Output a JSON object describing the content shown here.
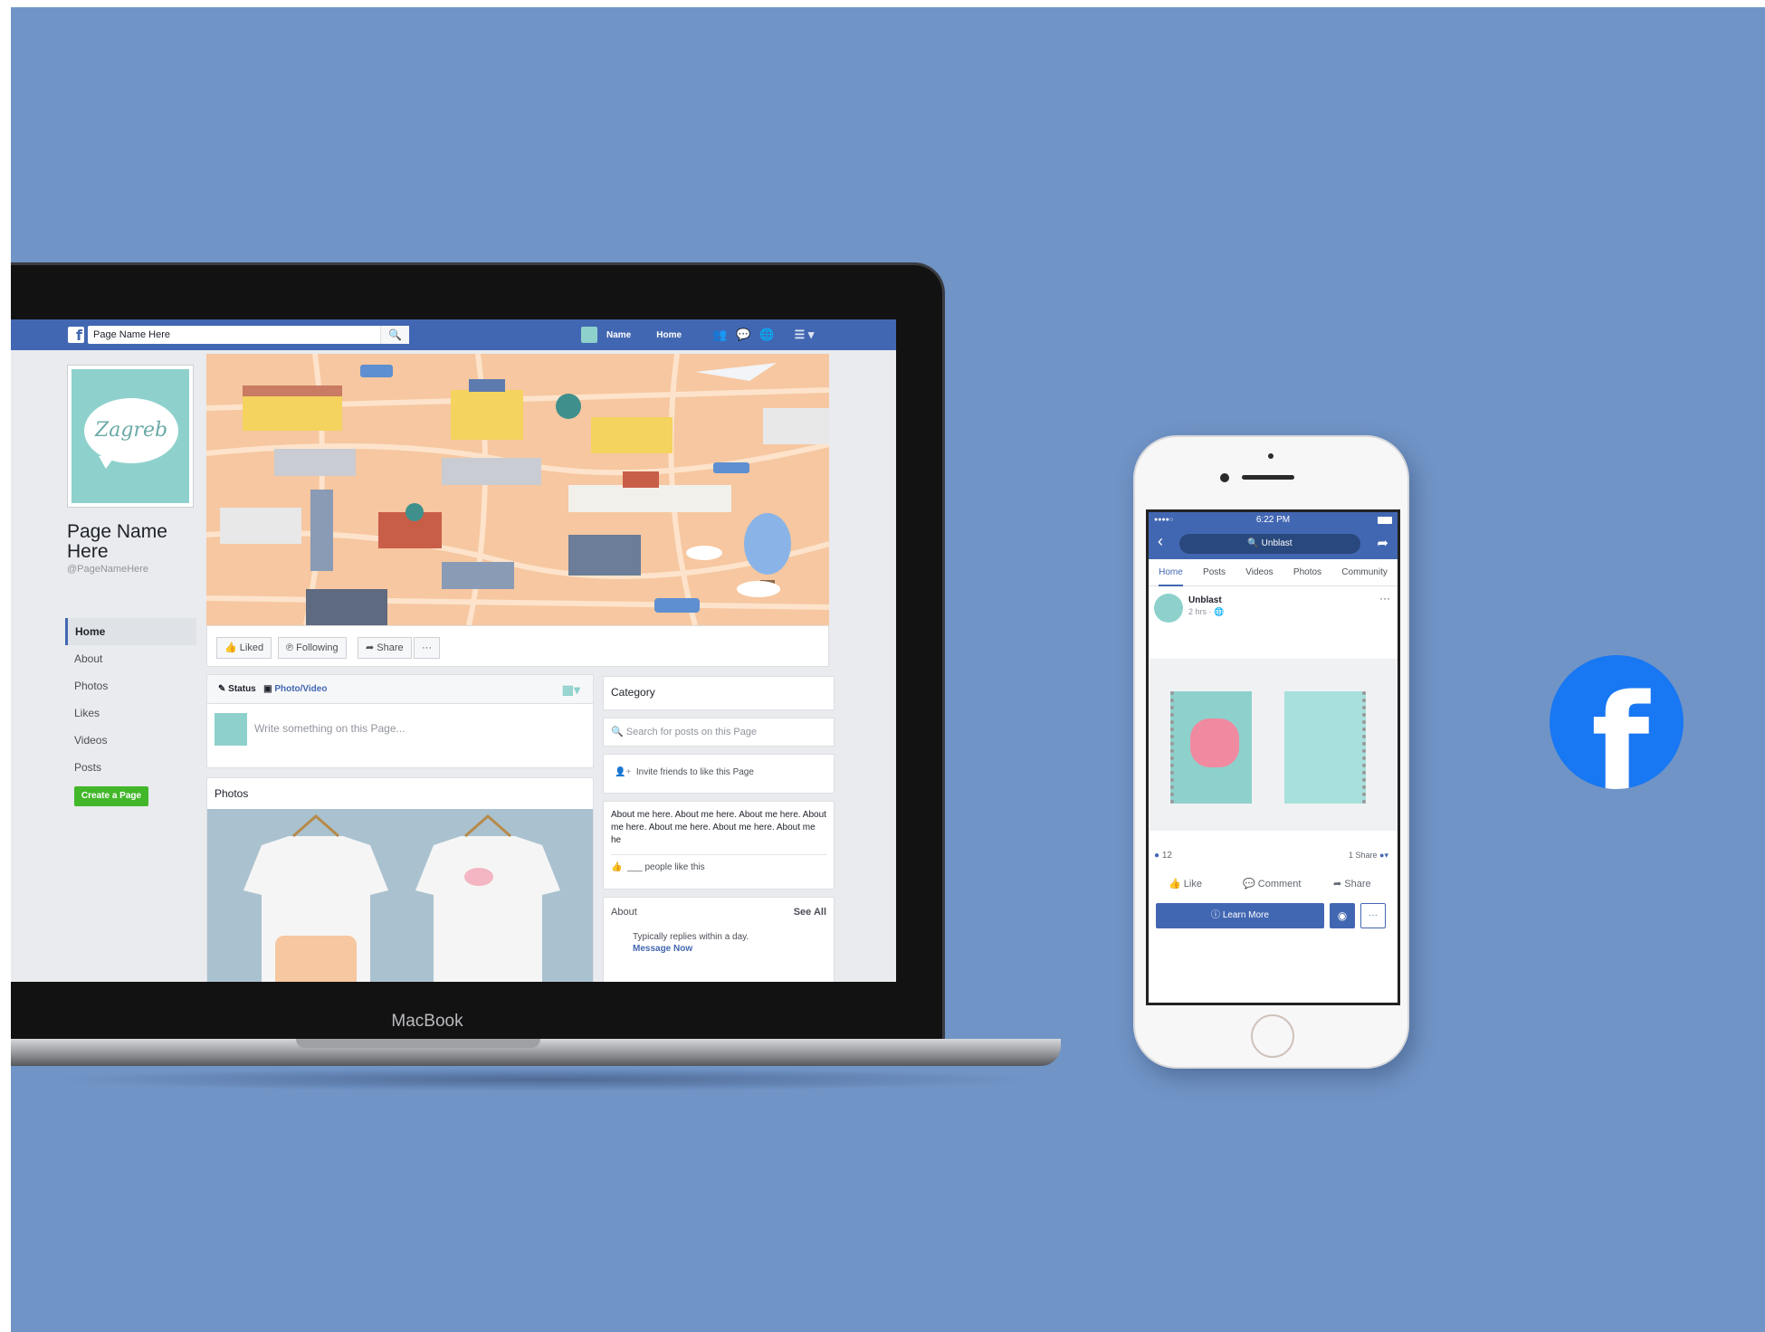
{
  "laptop": {
    "brand_label": "MacBook",
    "fb": {
      "search_value": "Page Name Here",
      "nav": {
        "name": "Name",
        "home": "Home"
      },
      "page_name": "Page Name Here",
      "page_handle": "@PageNameHere",
      "side_nav": [
        "Home",
        "About",
        "Photos",
        "Likes",
        "Videos",
        "Posts"
      ],
      "create_page": "Create a Page",
      "actions": {
        "liked": "Liked",
        "following": "Following",
        "share": "Share",
        "more": "···"
      },
      "composer": {
        "status": "Status",
        "photo_video": "Photo/Video",
        "placeholder": "Write something on this Page..."
      },
      "photos_title": "Photos",
      "right": {
        "category": "Category",
        "search_placeholder": "Search for posts on this Page",
        "invite": "Invite friends to like this Page",
        "about_text": "About me here. About me here. About me here. About me here. About me here. About me here. About me he",
        "people_like": "___ people like this",
        "about_title": "About",
        "see_all": "See All",
        "replies": "Typically replies within a day.",
        "message_now": "Message Now"
      }
    }
  },
  "phone": {
    "time": "6:22 PM",
    "signal": "●●●●○",
    "search": "Unblast",
    "tabs": [
      "Home",
      "Posts",
      "Videos",
      "Photos",
      "Community"
    ],
    "post": {
      "author": "Unblast",
      "meta": "2 hrs ·",
      "reactions": "12",
      "shares": "1 Share",
      "like": "Like",
      "comment": "Comment",
      "share": "Share",
      "cta": "Learn More",
      "more": "···"
    }
  },
  "colors": {
    "background": "#7094c6",
    "fb_blue": "#4267b2",
    "brand_blue": "#1877f2",
    "teal": "#8ed1cc",
    "map_bg": "#f6c7a0"
  }
}
